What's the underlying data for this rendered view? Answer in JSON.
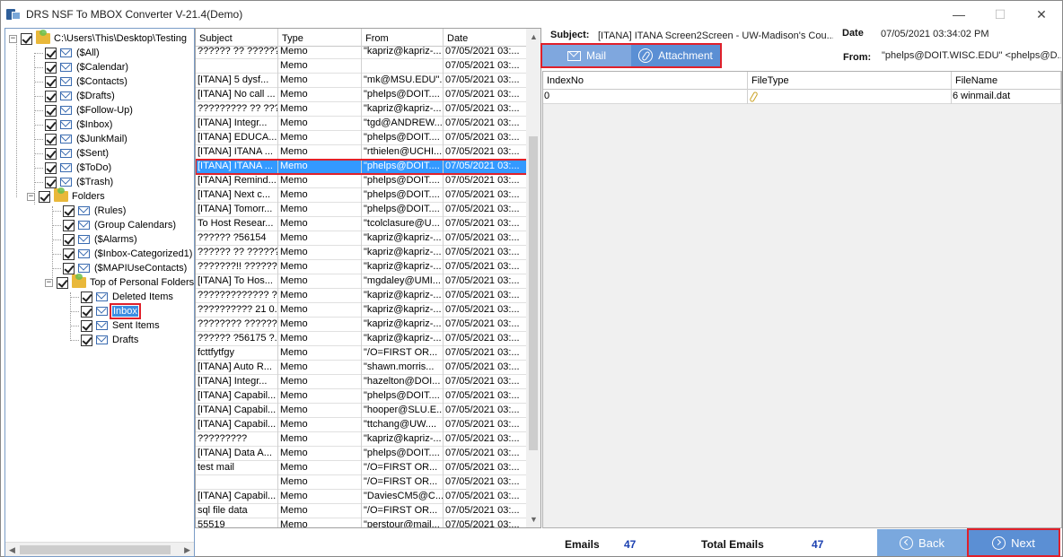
{
  "window": {
    "title": "DRS NSF To MBOX Converter V-21.4(Demo)",
    "minimize": "—",
    "maximize": "☐",
    "close": "✕"
  },
  "tree": {
    "root": "C:\\Users\\This\\Desktop\\Testing",
    "items": [
      "($All)",
      "($Calendar)",
      "($Contacts)",
      "($Drafts)",
      "($Follow-Up)",
      "($Inbox)",
      "($JunkMail)",
      "($Sent)",
      "($ToDo)",
      "($Trash)"
    ],
    "folders_label": "Folders",
    "folder_items": [
      "(Rules)",
      "(Group Calendars)",
      "($Alarms)",
      "($Inbox-Categorized1)",
      "($MAPIUseContacts)"
    ],
    "personal_label": "Top of Personal Folders",
    "personal_items": [
      "Deleted Items",
      "Inbox",
      "Sent Items",
      "Drafts"
    ],
    "selected": "Inbox"
  },
  "list": {
    "headers": [
      "Subject",
      "Type",
      "From",
      "Date"
    ],
    "rows": [
      [
        "?????? ?? ??????...",
        "Memo",
        "\"kapriz@kapriz-...",
        "07/05/2021 03:..."
      ],
      [
        "",
        "Memo",
        "",
        "07/05/2021 03:..."
      ],
      [
        "[ITANA]  5 dysf...",
        "Memo",
        "\"mk@MSU.EDU\"...",
        "07/05/2021 03:..."
      ],
      [
        "[ITANA] No call ...",
        "Memo",
        "\"phelps@DOIT....",
        "07/05/2021 03:..."
      ],
      [
        "????????? ?? ???...",
        "Memo",
        "\"kapriz@kapriz-...",
        "07/05/2021 03:..."
      ],
      [
        "[ITANA]  Integr...",
        "Memo",
        "\"tgd@ANDREW....",
        "07/05/2021 03:..."
      ],
      [
        "[ITANA] EDUCA...",
        "Memo",
        "\"phelps@DOIT....",
        "07/05/2021 03:..."
      ],
      [
        "[ITANA] ITANA ...",
        "Memo",
        "\"rthielen@UCHI...",
        "07/05/2021 03:..."
      ],
      [
        "[ITANA] ITANA ...",
        "Memo",
        "\"phelps@DOIT....",
        "07/05/2021 03:..."
      ],
      [
        "[ITANA] Remind...",
        "Memo",
        "\"phelps@DOIT....",
        "07/05/2021 03:..."
      ],
      [
        "[ITANA] Next c...",
        "Memo",
        "\"phelps@DOIT....",
        "07/05/2021 03:..."
      ],
      [
        "[ITANA] Tomorr...",
        "Memo",
        "\"phelps@DOIT....",
        "07/05/2021 03:..."
      ],
      [
        "To Host Resear...",
        "Memo",
        "\"tcolclasure@U...",
        "07/05/2021 03:..."
      ],
      [
        "?????? ?56154",
        "Memo",
        "\"kapriz@kapriz-...",
        "07/05/2021 03:..."
      ],
      [
        "?????? ?? ??????...",
        "Memo",
        "\"kapriz@kapriz-...",
        "07/05/2021 03:..."
      ],
      [
        "???????!! ???????...",
        "Memo",
        "\"kapriz@kapriz-...",
        "07/05/2021 03:..."
      ],
      [
        "[ITANA] To Hos...",
        "Memo",
        "\"mgdaley@UMI...",
        "07/05/2021 03:..."
      ],
      [
        "????????????? ?...",
        "Memo",
        "\"kapriz@kapriz-...",
        "07/05/2021 03:..."
      ],
      [
        "?????????? 21 0...",
        "Memo",
        "\"kapriz@kapriz-...",
        "07/05/2021 03:..."
      ],
      [
        "???????? ?????? ...",
        "Memo",
        "\"kapriz@kapriz-...",
        "07/05/2021 03:..."
      ],
      [
        "?????? ?56175 ?...",
        "Memo",
        "\"kapriz@kapriz-...",
        "07/05/2021 03:..."
      ],
      [
        "fcttfytfgy",
        "Memo",
        "\"/O=FIRST OR...",
        "07/05/2021 03:..."
      ],
      [
        "[ITANA] Auto R...",
        "Memo",
        "\"shawn.morris...",
        "07/05/2021 03:..."
      ],
      [
        "[ITANA] Integr...",
        "Memo",
        "\"hazelton@DOI...",
        "07/05/2021 03:..."
      ],
      [
        "[ITANA] Capabil...",
        "Memo",
        "\"phelps@DOIT....",
        "07/05/2021 03:..."
      ],
      [
        "[ITANA] Capabil...",
        "Memo",
        "\"hooper@SLU.E...",
        "07/05/2021 03:..."
      ],
      [
        "[ITANA] Capabil...",
        "Memo",
        "\"ttchang@UW....",
        "07/05/2021 03:..."
      ],
      [
        "?????????",
        "Memo",
        "\"kapriz@kapriz-...",
        "07/05/2021 03:..."
      ],
      [
        "[ITANA] Data A...",
        "Memo",
        "\"phelps@DOIT....",
        "07/05/2021 03:..."
      ],
      [
        "test mail",
        "Memo",
        "\"/O=FIRST OR...",
        "07/05/2021 03:..."
      ],
      [
        "",
        "Memo",
        "\"/O=FIRST OR...",
        "07/05/2021 03:..."
      ],
      [
        "[ITANA] Capabil...",
        "Memo",
        "\"DaviesCM5@C...",
        "07/05/2021 03:..."
      ],
      [
        "sql file data",
        "Memo",
        "\"/O=FIRST OR...",
        "07/05/2021 03:..."
      ],
      [
        "55519",
        "Memo",
        "\"perstour@mail...",
        "07/05/2021 03:..."
      ]
    ],
    "selected_index": 8
  },
  "detail": {
    "subject_label": "Subject:",
    "subject_value": "[ITANA] ITANA Screen2Screen - UW-Madison's Cou...",
    "date_label": "Date",
    "date_value": "07/05/2021 03:34:02 PM",
    "from_label": "From:",
    "from_value": "\"phelps@DOIT.WISC.EDU\" <phelps@D...",
    "tab_mail": "Mail",
    "tab_attachment": "Attachment"
  },
  "attachments": {
    "headers": [
      "IndexNo",
      "FileType",
      "FileName"
    ],
    "rows": [
      [
        "0",
        "",
        "6 winmail.dat"
      ]
    ]
  },
  "footer": {
    "emails_label": "Emails",
    "emails_value": "47",
    "total_label": "Total Emails",
    "total_value": "47",
    "back_label": "Back",
    "next_label": "Next"
  }
}
